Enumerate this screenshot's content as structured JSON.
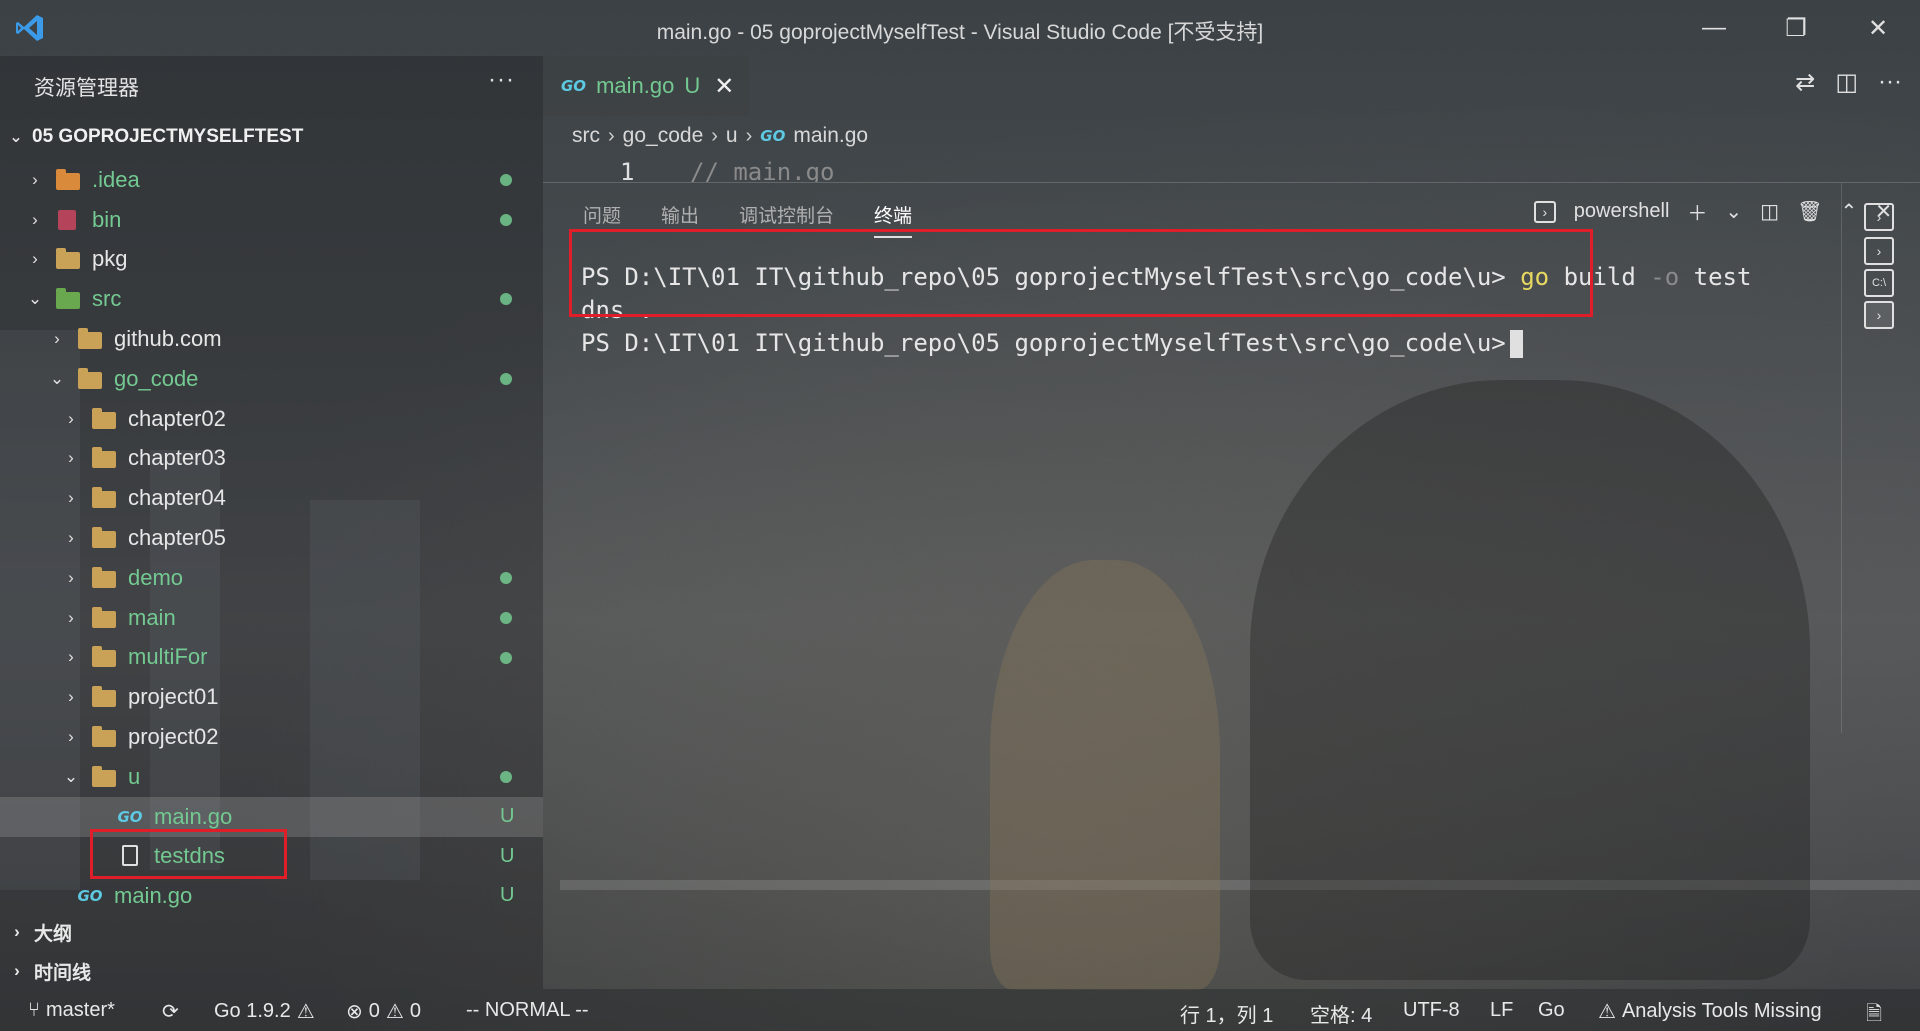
{
  "window": {
    "title": "main.go - 05 goprojectMyselfTest - Visual Studio Code [不受支持]",
    "controls": {
      "minimize": "—",
      "restore": "❐",
      "close": "✕"
    }
  },
  "sidebar": {
    "header": "资源管理器",
    "more": "···",
    "project": "05 GOPROJECTMYSELFTEST",
    "tree": [
      {
        "label": ".idea",
        "icon": "idea-folder-icon",
        "indent": 0,
        "chev": "›",
        "dot": true,
        "green": true
      },
      {
        "label": "bin",
        "icon": "bin-folder-icon",
        "indent": 0,
        "chev": "›",
        "dot": true,
        "green": true
      },
      {
        "label": "pkg",
        "icon": "folder-icon",
        "indent": 0,
        "chev": "›",
        "dot": false,
        "green": false
      },
      {
        "label": "src",
        "icon": "src-folder-icon",
        "indent": 0,
        "chev": "⌄",
        "dot": true,
        "green": true
      },
      {
        "label": "github.com",
        "icon": "folder-icon",
        "indent": 1,
        "chev": "›",
        "dot": false,
        "green": false
      },
      {
        "label": "go_code",
        "icon": "folder-icon",
        "indent": 1,
        "chev": "⌄",
        "dot": true,
        "green": true
      },
      {
        "label": "chapter02",
        "icon": "folder-icon",
        "indent": 2,
        "chev": "›",
        "dot": false,
        "green": false
      },
      {
        "label": "chapter03",
        "icon": "folder-icon",
        "indent": 2,
        "chev": "›",
        "dot": false,
        "green": false
      },
      {
        "label": "chapter04",
        "icon": "folder-icon",
        "indent": 2,
        "chev": "›",
        "dot": false,
        "green": false
      },
      {
        "label": "chapter05",
        "icon": "folder-icon",
        "indent": 2,
        "chev": "›",
        "dot": false,
        "green": false
      },
      {
        "label": "demo",
        "icon": "folder-icon",
        "indent": 2,
        "chev": "›",
        "dot": true,
        "green": true
      },
      {
        "label": "main",
        "icon": "folder-icon",
        "indent": 2,
        "chev": "›",
        "dot": true,
        "green": true
      },
      {
        "label": "multiFor",
        "icon": "folder-icon",
        "indent": 2,
        "chev": "›",
        "dot": true,
        "green": true
      },
      {
        "label": "project01",
        "icon": "folder-icon",
        "indent": 2,
        "chev": "›",
        "dot": false,
        "green": false
      },
      {
        "label": "project02",
        "icon": "folder-icon",
        "indent": 2,
        "chev": "›",
        "dot": false,
        "green": false
      },
      {
        "label": "u",
        "icon": "folder-icon",
        "indent": 2,
        "chev": "⌄",
        "dot": true,
        "green": true
      },
      {
        "label": "main.go",
        "icon": "go-file-icon",
        "indent": 3,
        "chev": "",
        "badge": "U",
        "green": true,
        "selected": true
      },
      {
        "label": "testdns",
        "icon": "file-icon",
        "indent": 3,
        "chev": "",
        "badge": "U",
        "green": true
      },
      {
        "label": "main.go",
        "icon": "go-file-icon",
        "indent": 1,
        "chev": "",
        "badge": "U",
        "green": true
      }
    ],
    "outline": "大纲",
    "timeline": "时间线"
  },
  "editor": {
    "tab": {
      "icon": "GO",
      "label": "main.go",
      "status": "U",
      "close": "✕"
    },
    "breadcrumb": [
      "src",
      "go_code",
      "u",
      "main.go"
    ],
    "line_number": "1",
    "line_text": "// main.go"
  },
  "panel": {
    "tabs": [
      "问题",
      "输出",
      "调试控制台",
      "终端"
    ],
    "active_tab": "终端",
    "shell": "powershell",
    "terminal": {
      "prompt1": "PS D:\\IT\\01 IT\\github_repo\\05 goprojectMyselfTest\\src\\go_code\\u>",
      "cmd_go": "go",
      "cmd_rest1": "build",
      "cmd_flag": "-o",
      "cmd_rest2": "test",
      "wrap": "dns .",
      "prompt2": "PS D:\\IT\\01 IT\\github_repo\\05 goprojectMyselfTest\\src\\go_code\\u>"
    }
  },
  "statusbar": {
    "branch": "master*",
    "go_version": "Go 1.9.2",
    "errors": "0",
    "warnings": "0",
    "mode": "-- NORMAL --",
    "position": "行 1，列 1",
    "spaces": "空格: 4",
    "encoding": "UTF-8",
    "eol": "LF",
    "language": "Go",
    "analysis": "Analysis Tools Missing"
  },
  "colors": {
    "accent_red": "#e01e2a",
    "untracked_green": "#73c991",
    "go_blue": "#5dc9e2",
    "term_yellow": "#e7d860"
  }
}
